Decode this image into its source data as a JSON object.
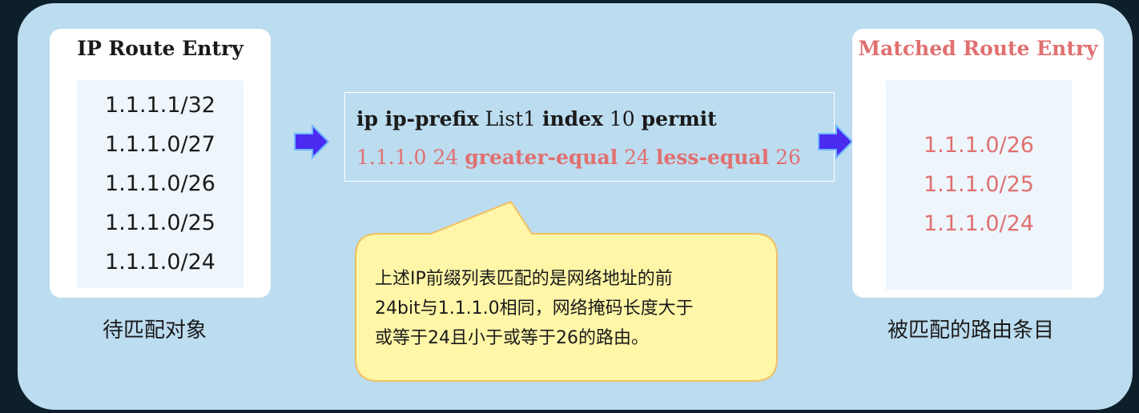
{
  "left_panel": {
    "title": "IP Route Entry",
    "entries": [
      "1.1.1.1/32",
      "1.1.1.0/27",
      "1.1.1.0/26",
      "1.1.1.0/25",
      "1.1.1.0/24"
    ],
    "caption": "待匹配对象"
  },
  "rule": {
    "line1": {
      "w1": "ip ip-prefix",
      "w2": "List1",
      "w3": "index",
      "w4": "10",
      "w5": "permit"
    },
    "line2": {
      "w1": "1.1.1.0 24",
      "w2": "greater-equal",
      "w3": "24",
      "w4": "less-equal",
      "w5": "26"
    }
  },
  "callout": {
    "lines": [
      "上述IP前缀列表匹配的是网络地址的前",
      "24bit与1.1.1.0相同，网络掩码长度大于",
      "或等于24且小于或等于26的路由。"
    ]
  },
  "right_panel": {
    "title": "Matched Route Entry",
    "entries": [
      "1.1.1.0/26",
      "1.1.1.0/25",
      "1.1.1.0/24"
    ],
    "caption": "被匹配的路由条目"
  },
  "colors": {
    "background": "#bcdcef",
    "highlight": "#e07070",
    "arrow": "#4a2cf0",
    "callout_fill": "#fff6a8"
  }
}
